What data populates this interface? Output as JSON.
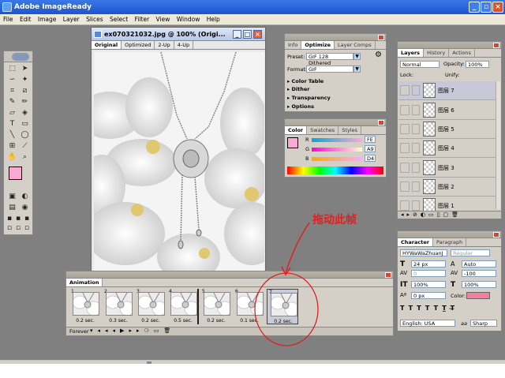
{
  "app": {
    "title": "Adobe ImageReady"
  },
  "menu": [
    "File",
    "Edit",
    "Image",
    "Layer",
    "Slices",
    "Select",
    "Filter",
    "View",
    "Window",
    "Help"
  ],
  "document": {
    "title": "ex070321032.jpg @ 100% (Origi...",
    "tabs": [
      "Original",
      "Optimized",
      "2-Up",
      "4-Up"
    ],
    "active_tab": "Original"
  },
  "optimize": {
    "tabs": [
      "Info",
      "Optimize",
      "Layer Comps"
    ],
    "active_tab": "Optimize",
    "preset_label": "Preset:",
    "preset_value": "GIF 128 Dithered",
    "format_label": "Format:",
    "format_value": "GIF",
    "sections": [
      "Color Table",
      "Dither",
      "Transparency",
      "Options"
    ]
  },
  "color": {
    "tabs": [
      "Color",
      "Swatches",
      "Styles"
    ],
    "active_tab": "Color",
    "r_label": "R",
    "g_label": "G",
    "b_label": "B",
    "r_value": "FE",
    "g_value": "A9",
    "b_value": "D4",
    "fg_color": "#f9a9d4"
  },
  "layers": {
    "tabs": [
      "Layers",
      "History",
      "Actions"
    ],
    "active_tab": "Layers",
    "blend_mode": "Normal",
    "opacity_label": "Opacity:",
    "opacity_value": "100%",
    "lock_label": "Lock:",
    "unify_label": "Unify:",
    "items": [
      {
        "name": "图层 7"
      },
      {
        "name": "图层 6"
      },
      {
        "name": "图层 5"
      },
      {
        "name": "图层 4"
      },
      {
        "name": "图层 3"
      },
      {
        "name": "图层 2"
      },
      {
        "name": "图层 1"
      }
    ]
  },
  "character": {
    "tabs": [
      "Character",
      "Paragraph"
    ],
    "active_tab": "Character",
    "font": "HYWaWaZhuanJ",
    "style": "Regular",
    "size": "24 px",
    "leading": "Auto",
    "kerning": "0",
    "tracking": "-100",
    "v_scale": "100%",
    "h_scale": "100%",
    "baseline": "0 px",
    "color_label": "Color:",
    "color_value": "#f080a0",
    "language": "English: USA",
    "aa_label": "aa",
    "antialias": "Sharp"
  },
  "animation": {
    "title": "Animation",
    "loop": "Forever",
    "frames": [
      {
        "num": "1",
        "delay": "0.2 sec."
      },
      {
        "num": "2",
        "delay": "0.3 sec."
      },
      {
        "num": "3",
        "delay": "0.2 sec."
      },
      {
        "num": "4",
        "delay": "0.5 sec."
      },
      {
        "num": "5",
        "delay": "0.2 sec."
      },
      {
        "num": "6",
        "delay": "0.1 sec."
      },
      {
        "num": "7",
        "delay": "0.2 sec."
      }
    ],
    "selected_frame": "7"
  },
  "annotation": {
    "text": "拖动此帧",
    "color": "#e02020"
  }
}
